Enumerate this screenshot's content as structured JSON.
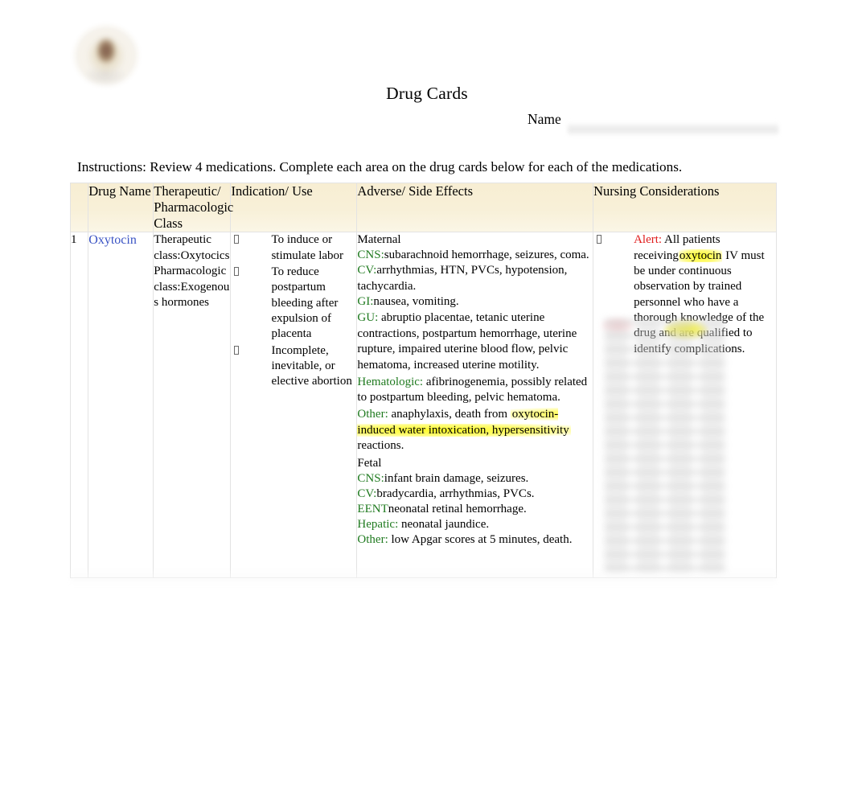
{
  "document": {
    "title": "Drug Cards",
    "name_label": "Name",
    "instructions": "Instructions: Review 4 medications.  Complete each area on the drug cards below for each of the medications.",
    "logo_alt": "school-crest-logo"
  },
  "table": {
    "headers": {
      "number": "",
      "drug_name": "Drug Name",
      "class": "Therapeutic/ Pharmacologic Class",
      "indication": "Indication/ Use",
      "adverse": "Adverse/ Side Effects",
      "nursing": "Nursing Considerations"
    },
    "rows": [
      {
        "number": "1",
        "drug_name": "Oxytocin",
        "class": {
          "therapeutic_label": "Therapeutic class:",
          "therapeutic_value": "Oxytocics",
          "pharmacologic_label": "Pharmacologic class:",
          "pharmacologic_value": "Exogenous hormones"
        },
        "indications": [
          "To induce or stimulate labor",
          "To reduce postpartum bleeding after expulsion of placenta",
          "Incomplete, inevitable, or elective abortion"
        ],
        "adverse": {
          "maternal_heading": "Maternal",
          "maternal": [
            {
              "system": "CNS:",
              "text": "subarachnoid hemorrhage, seizures, coma."
            },
            {
              "system": "CV:",
              "text": "arrhythmias,  HTN, PVCs, hypotension, tachycardia."
            },
            {
              "system": "GI:",
              "text": "nausea, vomiting."
            },
            {
              "system": "GU:",
              "text": " abruptio placentae,   tetanic uterine contractions,  postpartum hemorrhage, uterine rupture,  impaired uterine blood flow, pelvic hematoma, increased uterine motility."
            },
            {
              "system": "Hematologic:",
              "text": " afibrinogenemia, possibly related to postpartum bleeding, pelvic hematoma."
            },
            {
              "system": "Other:",
              "text": " anaphylaxis, death from ",
              "highlight": "oxytocin-induced water intoxication,  hypersensitivity",
              "tail": " reactions."
            }
          ],
          "fetal_heading": "Fetal",
          "fetal": [
            {
              "system": "CNS:",
              "text": "infant brain damage, seizures."
            },
            {
              "system": "CV:",
              "text": "bradycardia, arrhythmias,   PVCs."
            },
            {
              "system": "EENT",
              "text": "neonatal retinal hemorrhage."
            },
            {
              "system": "Hepatic:",
              "text": " neonatal jaundice."
            },
            {
              "system": "Other:",
              "text": " low Apgar scores at 5 minutes, death."
            }
          ]
        },
        "nursing": {
          "alert_label": "Alert:",
          "alert_pre": " All patients receiving",
          "alert_highlight": "oxytocin",
          "alert_post": " IV must be under continuous observation by trained personnel who have a thorough knowledge of the drug and are qualified to identify complications."
        }
      }
    ]
  },
  "colors": {
    "header_background": "#f8f0d8",
    "drug_name_link": "#3a53c4",
    "system_label": "#1f7a1f",
    "alert_text": "#e01b1b",
    "highlight": "#fffd38",
    "table_border": "#e3e3e3"
  }
}
